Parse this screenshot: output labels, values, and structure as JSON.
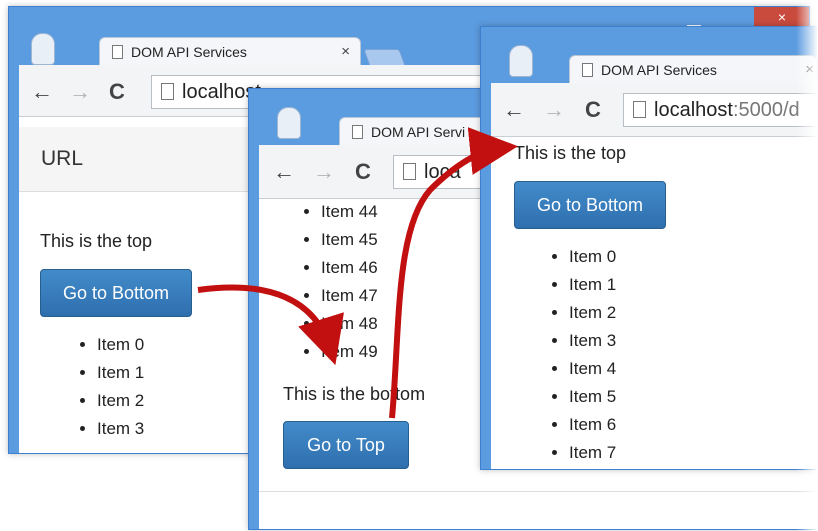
{
  "windows": {
    "left": {
      "tab_title": "DOM API Services",
      "tab_close": "×",
      "address": "localhost",
      "navbar_title": "URL",
      "top_text": "This is the top",
      "button_label": "Go to Bottom",
      "items": [
        "Item 0",
        "Item 1",
        "Item 2",
        "Item 3"
      ]
    },
    "middle": {
      "tab_title": "DOM API Servi",
      "address": "loca",
      "items": [
        "Item 44",
        "Item 45",
        "Item 46",
        "Item 47",
        "Item 48",
        "Item 49"
      ],
      "bottom_text": "This is the bottom",
      "button_label": "Go to Top"
    },
    "right": {
      "tab_title": "DOM API Services",
      "tab_close": "×",
      "address_host": "localhost",
      "address_rest": ":5000/d",
      "top_text": "This is the top",
      "button_label": "Go to Bottom",
      "items": [
        "Item 0",
        "Item 1",
        "Item 2",
        "Item 3",
        "Item 4",
        "Item 5",
        "Item 6",
        "Item 7"
      ]
    }
  },
  "window_controls": {
    "close": "×"
  },
  "icons": {
    "back": "←",
    "forward": "→",
    "reload": "C"
  },
  "colors": {
    "frame": "#5b9be0",
    "button": "#428bca",
    "arrow": "#c1100f",
    "close": "#c94b3e"
  }
}
